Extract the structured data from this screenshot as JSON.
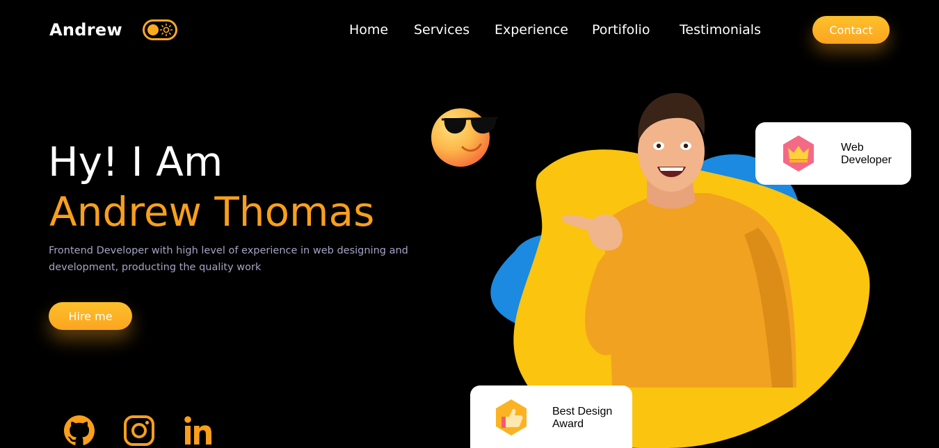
{
  "header": {
    "logo": "Andrew",
    "nav": [
      "Home",
      "Services",
      "Experience",
      "Portifolio",
      "Testimonials"
    ],
    "contact_label": "Contact"
  },
  "hero": {
    "greeting": "Hy! I Am",
    "name": "Andrew Thomas",
    "description": "Frontend Developer with high level of experience in web designing and development, producting the quality work",
    "hire_label": "Hire me"
  },
  "cards": {
    "web": {
      "line1": "Web",
      "line2": "Developer",
      "icon": "crown-icon"
    },
    "award": {
      "line1": "Best Design",
      "line2": "Award",
      "icon": "thumbs-up-icon"
    }
  },
  "social": [
    "github-icon",
    "instagram-icon",
    "linkedin-icon"
  ],
  "colors": {
    "accent": "#f99f1c",
    "button": "#fdb428",
    "blob_yellow": "#fbc40f",
    "blob_blue": "#1b8ae0",
    "background": "#000000",
    "desc_text": "#a4a4c4"
  }
}
